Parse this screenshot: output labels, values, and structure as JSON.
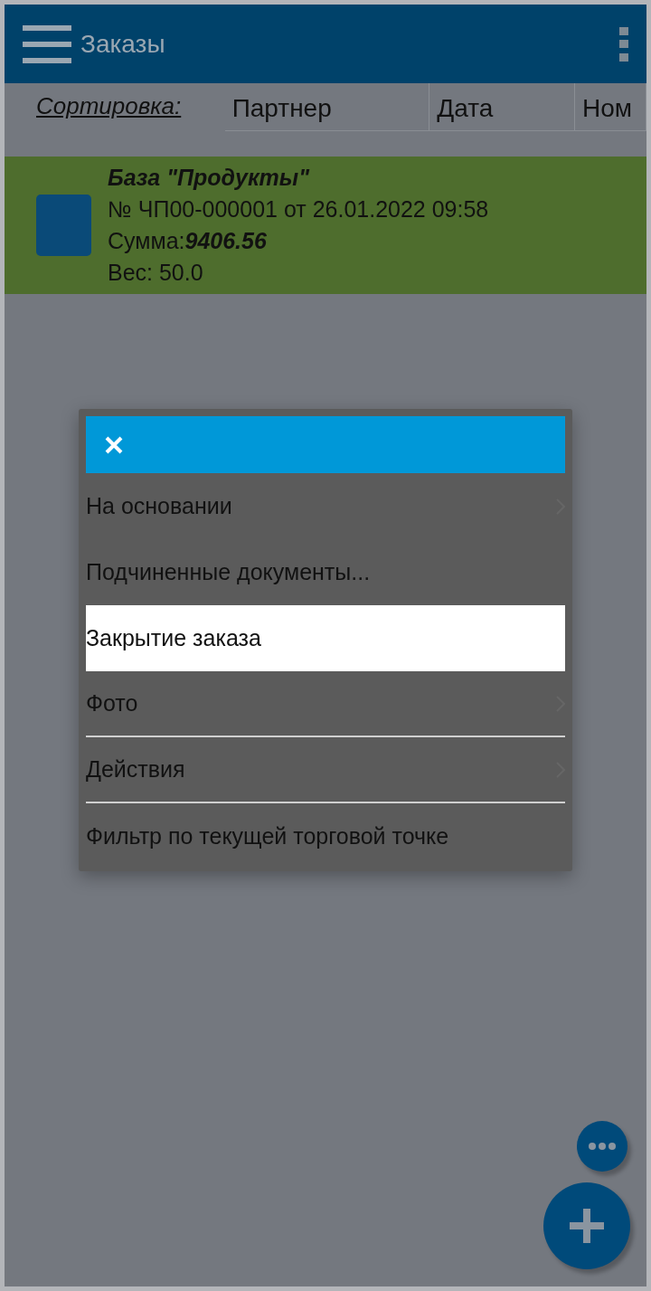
{
  "app_bar": {
    "title": "Заказы"
  },
  "sort_bar": {
    "label": "Сортировка:",
    "columns": [
      {
        "label": "Партнер"
      },
      {
        "label": "Дата"
      },
      {
        "label": "Ном"
      }
    ]
  },
  "orders": [
    {
      "partner": "База \"Продукты\"",
      "number": "№ ЧП00-000001 от 26.01.2022 09:58",
      "sum_label": "Сумма:",
      "sum": "9406.56",
      "weight": "Вес: 50.0",
      "color": "#4e6d2d"
    }
  ],
  "menu": {
    "items": [
      {
        "label": "На основании",
        "selected": false,
        "submenu": true,
        "divider_after": false
      },
      {
        "label": "Подчиненные документы...",
        "selected": false,
        "submenu": false,
        "divider_after": false
      },
      {
        "label": "Закрытие заказа",
        "selected": true,
        "submenu": false,
        "divider_after": false
      },
      {
        "label": "Фото",
        "selected": false,
        "submenu": true,
        "divider_after": true
      },
      {
        "label": "Действия",
        "selected": false,
        "submenu": true,
        "divider_after": true
      },
      {
        "label": "Фильтр по текущей торговой точке",
        "selected": false,
        "submenu": false,
        "divider_after": false
      }
    ]
  }
}
